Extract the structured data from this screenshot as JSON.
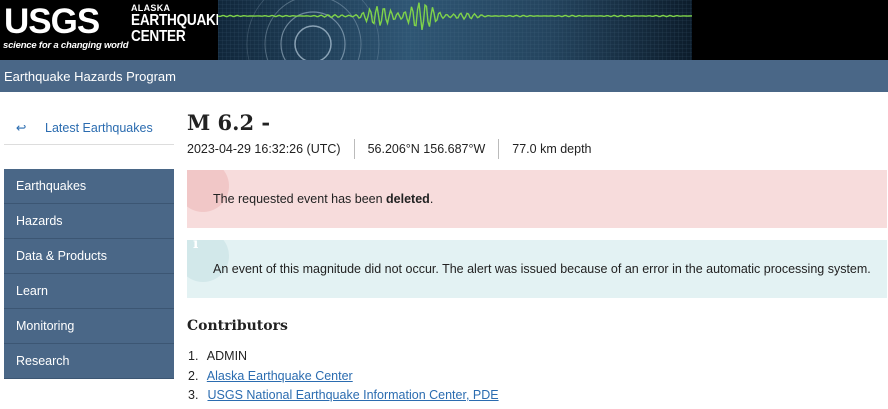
{
  "header": {
    "logo_word": "USGS",
    "logo_tagline": "science for a changing world",
    "center_line1": "ALASKA",
    "center_line2": "EARTHQUAKE",
    "center_line3": "CENTER"
  },
  "program_bar": {
    "label": "Earthquake Hazards Program"
  },
  "sidebar": {
    "back_link": "Latest Earthquakes",
    "back_arrow": "↩",
    "nav": [
      "Earthquakes",
      "Hazards",
      "Data & Products",
      "Learn",
      "Monitoring",
      "Research"
    ]
  },
  "event": {
    "title": "M 6.2 -",
    "time": "2023-04-29 16:32:26 (UTC)",
    "location": "56.206°N 156.687°W",
    "depth": "77.0 km depth"
  },
  "alerts": {
    "danger_prefix": "The requested event has been ",
    "danger_bold": "deleted",
    "danger_suffix": ".",
    "info_glyph": "i",
    "info_text": "An event of this magnitude did not occur. The alert was issued because of an error in the automatic processing system."
  },
  "contributors": {
    "heading": "Contributors",
    "items": [
      {
        "num": "1.",
        "label": "ADMIN",
        "link": false
      },
      {
        "num": "2.",
        "label": "Alaska Earthquake Center",
        "link": true
      },
      {
        "num": "3.",
        "label": "USGS National Earthquake Information Center, PDE",
        "link": true
      }
    ]
  },
  "colors": {
    "nav_bg": "#4a6787",
    "link": "#2b6cb0",
    "danger_bg": "#f7dcdc",
    "info_bg": "#e3f2f3",
    "seismo": "#7fd34a"
  }
}
